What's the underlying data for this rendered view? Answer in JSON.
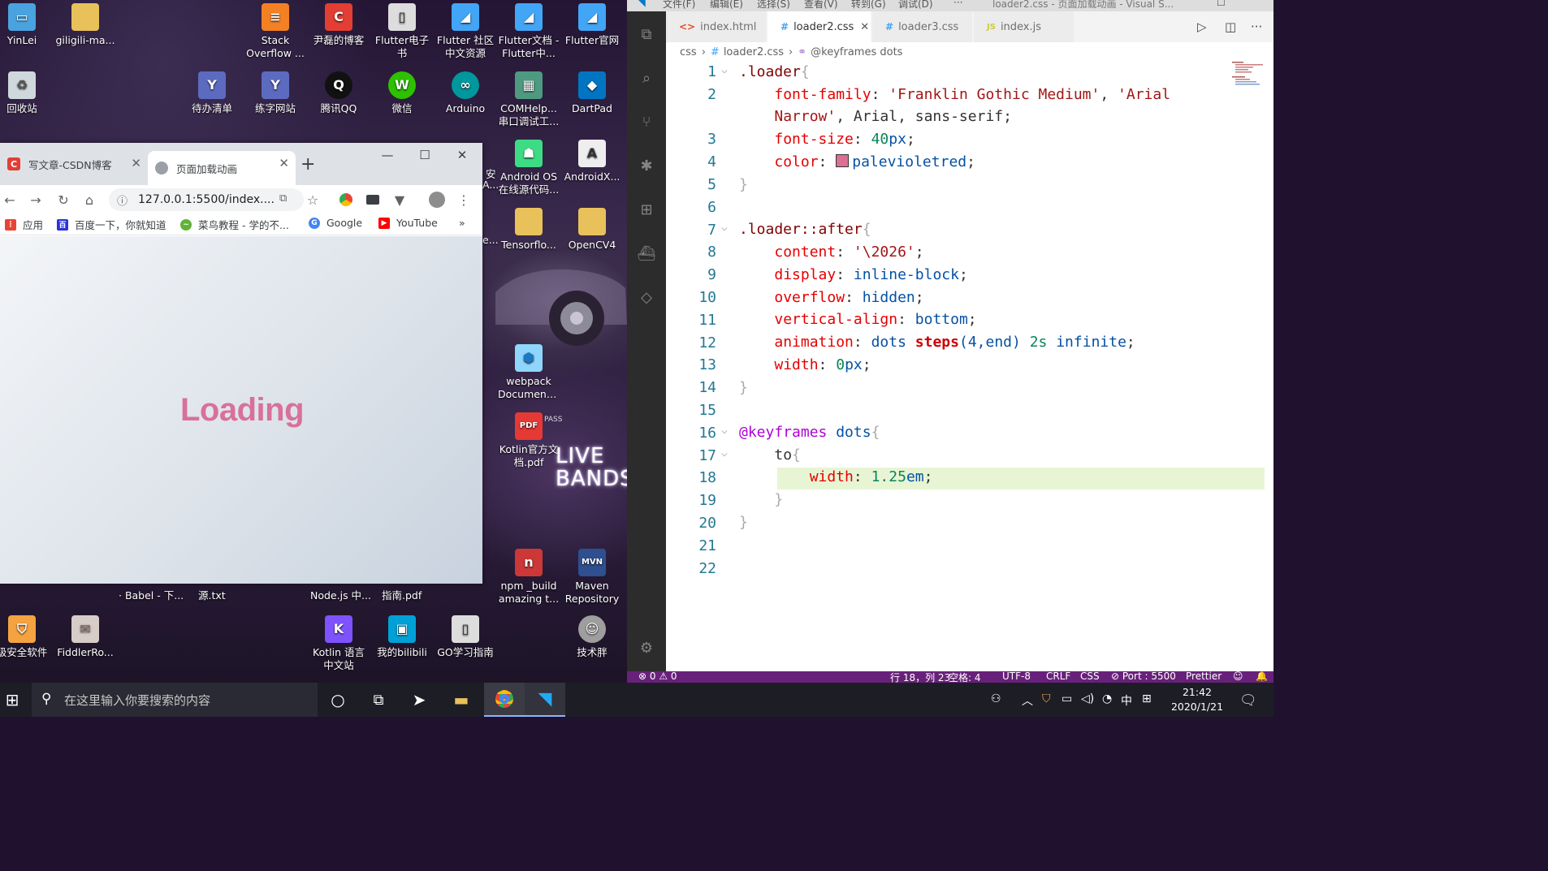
{
  "desktop": {
    "icons": [
      {
        "label": "YinLei",
        "icon": "computer-icon",
        "color": "#4aa3df"
      },
      {
        "label": "giligili-ma...",
        "icon": "folder-icon",
        "color": "#e8c15a"
      },
      {
        "label": "Stack Overflow ...",
        "icon": "stackoverflow-icon",
        "color": "#f48024"
      },
      {
        "label": "尹磊的博客",
        "icon": "csdn-icon",
        "color": "#e33e33"
      },
      {
        "label": "Flutter电子书",
        "icon": "book-icon",
        "color": "#dddddd"
      },
      {
        "label": "Flutter 社区中文资源",
        "icon": "flutter-icon",
        "color": "#42a5f5"
      },
      {
        "label": "Flutter文档 - Flutter中...",
        "icon": "flutter-icon",
        "color": "#42a5f5"
      },
      {
        "label": "Flutter官网",
        "icon": "flutter-icon",
        "color": "#42a5f5"
      },
      {
        "label": "回收站",
        "icon": "recycle-bin-icon",
        "color": "#cfd8dc"
      },
      {
        "label": "待办清单",
        "icon": "shortcut-icon",
        "color": "#5c6bc0"
      },
      {
        "label": "练字网站",
        "icon": "shortcut-icon",
        "color": "#5c6bc0"
      },
      {
        "label": "腾讯QQ",
        "icon": "qq-icon",
        "color": "#111111"
      },
      {
        "label": "微信",
        "icon": "wechat-icon",
        "color": "#2dc100"
      },
      {
        "label": "Arduino",
        "icon": "arduino-icon",
        "color": "#00979d"
      },
      {
        "label": "COMHelp... 串口调试工...",
        "icon": "app-icon",
        "color": "#4e9a80"
      },
      {
        "label": "DartPad",
        "icon": "dart-icon",
        "color": "#0175c2"
      },
      {
        "label": "Android OS 在线源代码...",
        "icon": "android-icon",
        "color": "#3ddc84"
      },
      {
        "label": "AndroidX...",
        "icon": "document-icon",
        "color": "#eeeeee"
      },
      {
        "label": "Tensorflo...",
        "icon": "folder-icon",
        "color": "#e8c15a"
      },
      {
        "label": "OpenCV4",
        "icon": "folder-icon",
        "color": "#e8c15a"
      },
      {
        "label": "webpack Document...",
        "icon": "webpack-icon",
        "color": "#8ed6fb"
      },
      {
        "label": "Kotlin官方文档.pdf",
        "icon": "pdf-icon",
        "color": "#e53935"
      },
      {
        "label": "npm _build amazing t...",
        "icon": "npm-icon",
        "color": "#cb3837"
      },
      {
        "label": "Maven Repository",
        "icon": "maven-icon",
        "color": "#2f4f8f"
      },
      {
        "label": "Kotlin 语言中文站",
        "icon": "kotlin-icon",
        "color": "#7f52ff"
      },
      {
        "label": "我的bilibili",
        "icon": "bilibili-icon",
        "color": "#00a1d6"
      },
      {
        "label": "GO学习指南",
        "icon": "book-icon",
        "color": "#dddddd"
      },
      {
        "label": "技术胖",
        "icon": "avatar-icon",
        "color": "#9e9e9e"
      },
      {
        "label": "级安全软件",
        "icon": "shield-icon",
        "color": "#f4a340"
      },
      {
        "label": "FiddlerRo...",
        "icon": "certificate-icon",
        "color": "#d7ccc8"
      }
    ],
    "partial_labels": [
      "· Babel - 下...",
      "源.txt",
      "Node.js 中...",
      "指南.pdf",
      "安",
      "A...",
      "e..."
    ],
    "wallpaper_text": "LIVE BANDS",
    "pass_text": "PASS"
  },
  "browser": {
    "tabs": [
      {
        "label": "写文章-CSDN博客",
        "icon": "csdn-icon",
        "color": "#e33e33",
        "active": false
      },
      {
        "label": "页面加载动画",
        "icon": "globe-icon",
        "color": "#9aa0a6",
        "active": true
      }
    ],
    "new_tab": "+",
    "url": "127.0.0.1:5500/index....",
    "bookmarks": [
      {
        "label": "应用",
        "icon": "apps-icon",
        "color": "#ea4335"
      },
      {
        "label": "百度一下，你就知道",
        "icon": "baidu-icon",
        "color": "#2932e1"
      },
      {
        "label": "菜鸟教程 - 学的不...",
        "icon": "runoob-icon",
        "color": "#5fb336"
      },
      {
        "label": "Google",
        "icon": "google-icon",
        "color": "#4285f4"
      },
      {
        "label": "YouTube",
        "icon": "youtube-icon",
        "color": "#ff0000"
      }
    ],
    "bookmarks_more": "»",
    "page": {
      "text": "Loading",
      "text_color": "#db7093"
    }
  },
  "vscode": {
    "title": "loader2.css - 页面加载动画 - Visual S...",
    "menu": [
      "文件(F)",
      "编辑(E)",
      "选择(S)",
      "查看(V)",
      "转到(G)",
      "调试(D)",
      "···"
    ],
    "tabs": [
      {
        "label": "index.html",
        "icon": "html-icon",
        "glyph": "<>",
        "color": "#e44d26",
        "active": false
      },
      {
        "label": "loader2.css",
        "icon": "css-icon",
        "glyph": "#",
        "color": "#42a5f5",
        "active": true
      },
      {
        "label": "loader3.css",
        "icon": "css-icon",
        "glyph": "#",
        "color": "#42a5f5",
        "active": false
      },
      {
        "label": "index.js",
        "icon": "js-icon",
        "glyph": "JS",
        "color": "#cbcb41",
        "active": false
      }
    ],
    "breadcrumb": [
      "css",
      "loader2.css",
      "@keyframes dots"
    ],
    "line_numbers": [
      "1",
      "2",
      "",
      "3",
      "4",
      "5",
      "6",
      "7",
      "8",
      "9",
      "10",
      "11",
      "12",
      "13",
      "14",
      "15",
      "16",
      "17",
      "18",
      "19",
      "20",
      "21",
      "22"
    ],
    "code": {
      "l1": {
        "sel": ".loader",
        "brace": "{"
      },
      "l2": {
        "prop": "font-family",
        "s1": "'Franklin Gothic Medium'",
        "s2": "'Arial"
      },
      "l2b": {
        "s2": "Narrow'",
        "rest": ", Arial, sans-serif;"
      },
      "l3": {
        "prop": "font-size",
        "num": "40",
        "unit": "px"
      },
      "l4": {
        "prop": "color",
        "val": "palevioletred",
        "swatch": "#db7093"
      },
      "l5": "}",
      "l7": {
        "sel": ".loader::after",
        "brace": "{"
      },
      "l8": {
        "prop": "content",
        "str": "'\\2026'"
      },
      "l9": {
        "prop": "display",
        "val": "inline-block"
      },
      "l10": {
        "prop": "overflow",
        "val": "hidden"
      },
      "l11": {
        "prop": "vertical-align",
        "val": "bottom"
      },
      "l12": {
        "prop": "animation",
        "v1": "dots",
        "fn": "steps",
        "args": "(4,end)",
        "dur": "2s",
        "v2": "infinite"
      },
      "l13": {
        "prop": "width",
        "num": "0",
        "unit": "px"
      },
      "l14": "}",
      "l16": {
        "at": "@keyframes",
        "name": "dots",
        "brace": "{"
      },
      "l17": {
        "kw": "to",
        "brace": "{"
      },
      "l18": {
        "prop": "width",
        "num": "1.25",
        "unit": "em"
      },
      "l19": "}",
      "l20": "}"
    },
    "status": {
      "problems": "⊗ 0 ⚠ 0",
      "position": "行 18，列 23",
      "spaces": "空格: 4",
      "encoding": "UTF-8",
      "eol": "CRLF",
      "lang": "CSS",
      "port": "⊘ Port : 5500",
      "formatter": "Prettier"
    }
  },
  "taskbar": {
    "search_placeholder": "在这里输入你要搜索的内容",
    "ime": "中",
    "time": "21:42",
    "date": "2020/1/21"
  }
}
